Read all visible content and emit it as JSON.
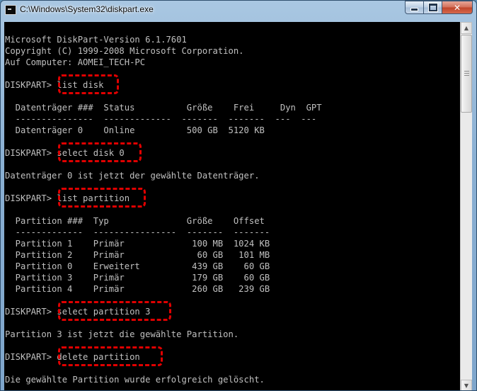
{
  "window": {
    "title": "C:\\Windows\\System32\\diskpart.exe",
    "icon": "console-app-icon",
    "controls": {
      "minimize": "minimize-icon",
      "maximize": "maximize-icon",
      "close": "✕"
    }
  },
  "console": {
    "lines": [
      "Microsoft DiskPart-Version 6.1.7601",
      "Copyright (C) 1999-2008 Microsoft Corporation.",
      "Auf Computer: AOMEI_TECH-PC",
      "",
      "DISKPART> list disk",
      "",
      "  Datenträger ###  Status          Größe    Frei     Dyn  GPT",
      "  ---------------  -------------  -------  -------  ---  ---",
      "  Datenträger 0    Online          500 GB  5120 KB",
      "",
      "DISKPART> select disk 0",
      "",
      "Datenträger 0 ist jetzt der gewählte Datenträger.",
      "",
      "DISKPART> list partition",
      "",
      "  Partition ###  Typ               Größe    Offset",
      "  -------------  ----------------  -------  -------",
      "  Partition 1    Primär             100 MB  1024 KB",
      "  Partition 2    Primär              60 GB   101 MB",
      "  Partition 0    Erweitert          439 GB    60 GB",
      "  Partition 3    Primär             179 GB    60 GB",
      "  Partition 4    Primär             260 GB   239 GB",
      "",
      "DISKPART> select partition 3",
      "",
      "Partition 3 ist jetzt die gewählte Partition.",
      "",
      "DISKPART> delete partition",
      "",
      "Die gewählte Partition wurde erfolgreich gelöscht."
    ]
  },
  "highlight_color": "#e00000",
  "console_text_color": "#c0c0c0",
  "console_background": "#000000"
}
